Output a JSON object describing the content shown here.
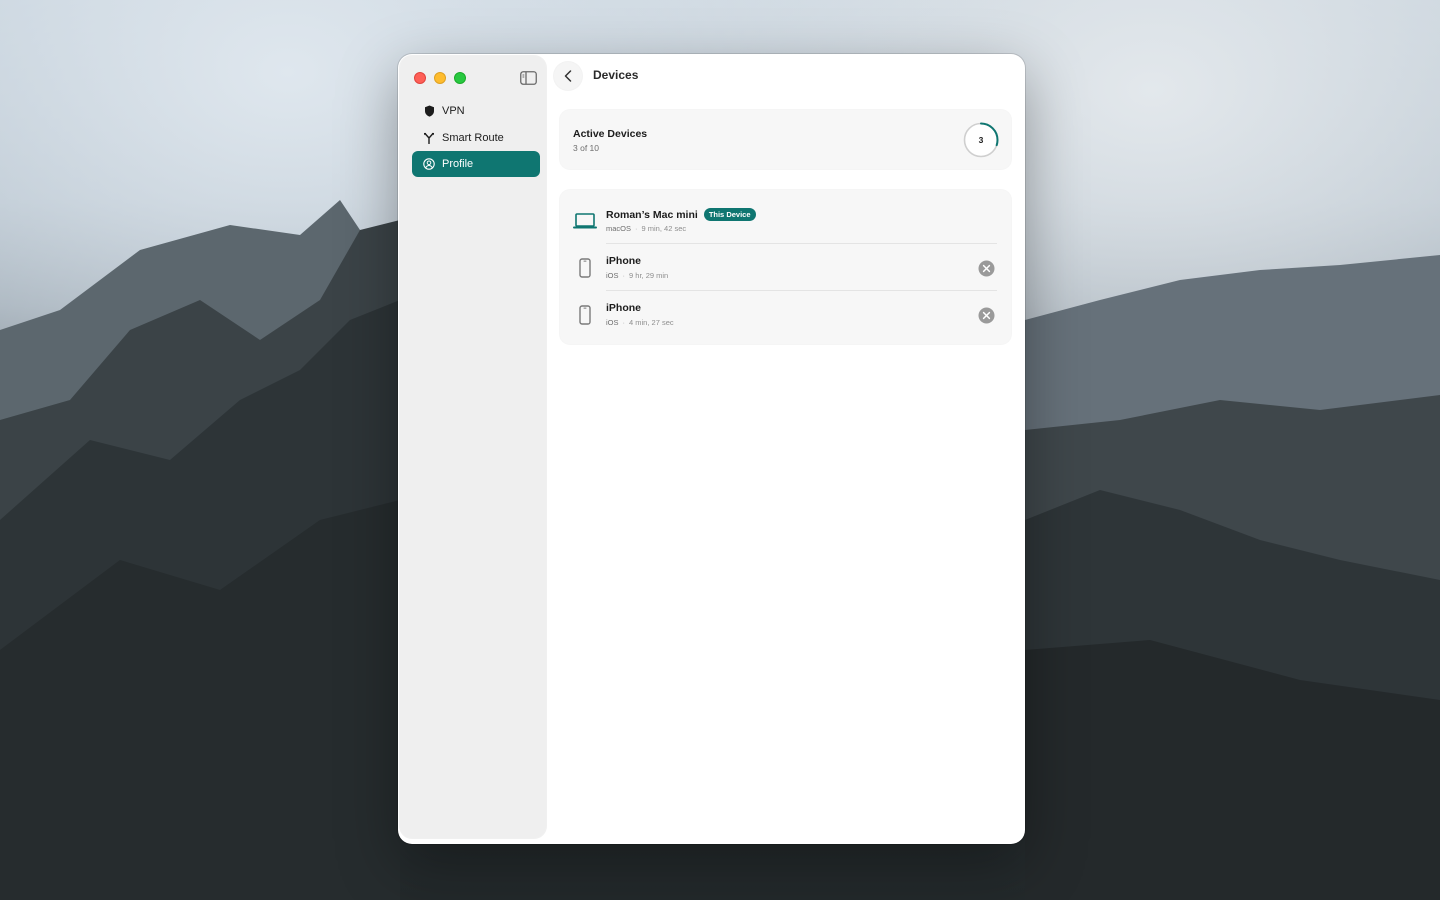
{
  "window": {
    "title": "Devices"
  },
  "sidebar": {
    "items": [
      {
        "label": "VPN",
        "icon": "shield-icon",
        "active": false
      },
      {
        "label": "Smart Route",
        "icon": "route-split-icon",
        "active": false
      },
      {
        "label": "Profile",
        "icon": "person-circle-icon",
        "active": true
      }
    ]
  },
  "active_devices": {
    "title": "Active Devices",
    "summary": "3 of 10",
    "count": "3",
    "progress_fraction": 0.3
  },
  "devices": [
    {
      "name": "Roman’s Mac mini",
      "badge": "This Device",
      "os": "macOS",
      "duration": "9 min, 42 sec",
      "icon": "laptop-icon"
    },
    {
      "name": "iPhone",
      "os": "iOS",
      "duration": "9 hr, 29 min",
      "icon": "phone-icon"
    },
    {
      "name": "iPhone",
      "os": "iOS",
      "duration": "4 min, 27 sec",
      "icon": "phone-icon"
    }
  ],
  "colors": {
    "accent": "#0f7671",
    "close": "#fe5f57",
    "minimize": "#febc2e",
    "zoom": "#28c840"
  }
}
